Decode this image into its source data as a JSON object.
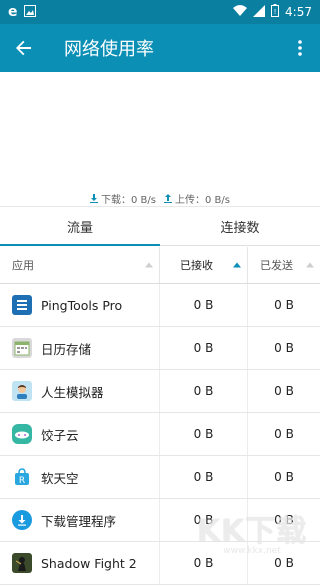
{
  "status_bar": {
    "time": "4:57",
    "left_icons": [
      "browser-e-icon",
      "image-icon"
    ],
    "right_icons": [
      "wifi-icon",
      "signal-icon",
      "battery-icon"
    ]
  },
  "app_bar": {
    "title": "网络使用率",
    "back_icon": "arrow-back-icon",
    "more_icon": "more-vert-icon",
    "color": "#0b8fb5"
  },
  "speed": {
    "download_label": "下载：0 B/s",
    "upload_label": "上传：0 B/s"
  },
  "tabs": [
    {
      "label": "流量",
      "active": true
    },
    {
      "label": "连接数",
      "active": false
    }
  ],
  "table": {
    "headers": {
      "app": "应用",
      "received": "已接收",
      "sent": "已发送"
    },
    "sorted_by": "received",
    "rows": [
      {
        "name": "PingTools Pro",
        "received": "0 B",
        "sent": "0 B",
        "icon": "pingtools-icon"
      },
      {
        "name": "日历存储",
        "received": "0 B",
        "sent": "0 B",
        "icon": "calendar-icon"
      },
      {
        "name": "人生模拟器",
        "received": "0 B",
        "sent": "0 B",
        "icon": "avatar-icon"
      },
      {
        "name": "饺子云",
        "received": "0 B",
        "sent": "0 B",
        "icon": "cloud-app-icon"
      },
      {
        "name": "软天空",
        "received": "0 B",
        "sent": "0 B",
        "icon": "bag-app-icon"
      },
      {
        "name": "下载管理程序",
        "received": "0 B",
        "sent": "0 B",
        "icon": "download-manager-icon"
      },
      {
        "name": "Shadow Fight 2",
        "received": "0 B",
        "sent": "0 B",
        "icon": "game-icon"
      }
    ]
  },
  "watermark": {
    "text": "KK下载",
    "url": "www.kkx.net"
  }
}
